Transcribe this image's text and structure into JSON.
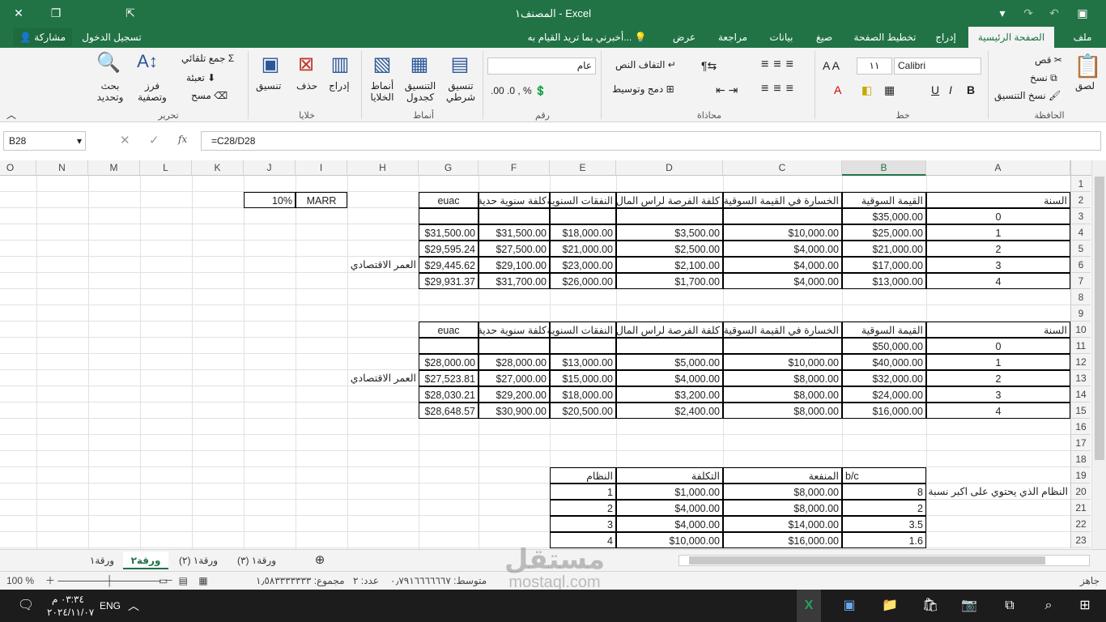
{
  "window": {
    "title": "المصنف١ - Excel",
    "close_glyph": "✕",
    "restore_glyph": "❐",
    "minimize_glyph": "⇱",
    "save_glyph": "▣",
    "undo_glyph": "↶",
    "redo_glyph": "↷",
    "customize_glyph": "▾"
  },
  "tabs": {
    "share": "مشاركة",
    "signin": "تسجيل الدخول",
    "tellme": "أخبرني بما تريد القيام به...",
    "items": [
      "ملف",
      "الصفحة الرئيسية",
      "إدراج",
      "تخطيط الصفحة",
      "صيغ",
      "بيانات",
      "مراجعة",
      "عرض"
    ]
  },
  "ribbon": {
    "clipboard": {
      "label": "الحافظة",
      "paste": "لصق",
      "cut": "قص",
      "copy": "نسخ",
      "format_painter": "نسخ التنسيق"
    },
    "font": {
      "label": "خط",
      "name": "Calibri",
      "size": "١١"
    },
    "alignment": {
      "label": "محاذاة",
      "wrap": "التفاف النص",
      "merge": "دمج وتوسيط"
    },
    "number": {
      "label": "رقم",
      "format": "عام"
    },
    "styles": {
      "label": "أنماط",
      "conditional": "تنسيق شرطي",
      "as_table": "التنسيق كجدول",
      "cell_styles": "أنماط الخلايا"
    },
    "cells": {
      "label": "خلايا",
      "insert": "إدراج",
      "delete": "حذف",
      "format": "تنسيق"
    },
    "editing": {
      "label": "تحرير",
      "autosum": "جمع تلقائي",
      "fill": "تعبئة",
      "clear": "مسح",
      "sort": "فرز وتصفية",
      "find": "بحث وتحديد"
    }
  },
  "formula_bar": {
    "name_box": "B28",
    "fx": "fx",
    "formula": "=C28/D28"
  },
  "grid": {
    "columns": [
      "A",
      "B",
      "C",
      "D",
      "E",
      "F",
      "G",
      "H",
      "I",
      "J",
      "K",
      "L",
      "M",
      "N",
      "O"
    ],
    "selected_column": "B",
    "rows": [
      "1",
      "2",
      "3",
      "4",
      "5",
      "6",
      "7",
      "8",
      "9",
      "10",
      "11",
      "12",
      "13",
      "14",
      "15",
      "16",
      "17",
      "18",
      "19",
      "20",
      "21",
      "22",
      "23"
    ],
    "headers": [
      "السنة",
      "القيمة السوقية",
      "الخسارة في القيمة السوقية",
      "كلفة الفرصة لراس المال",
      "النفقات السنوية",
      "كلفة سنوية حدية",
      "euac"
    ],
    "marr_label": "MARR",
    "marr_value": "10%",
    "economic_life": "العمر الاقتصادي",
    "table1": [
      [
        "0",
        "$35,000.00",
        "",
        "",
        "",
        "",
        ""
      ],
      [
        "1",
        "$25,000.00",
        "$10,000.00",
        "$3,500.00",
        "$18,000.00",
        "$31,500.00",
        "$31,500.00"
      ],
      [
        "2",
        "$21,000.00",
        "$4,000.00",
        "$2,500.00",
        "$21,000.00",
        "$27,500.00",
        "$29,595.24"
      ],
      [
        "3",
        "$17,000.00",
        "$4,000.00",
        "$2,100.00",
        "$23,000.00",
        "$29,100.00",
        "$29,445.62"
      ],
      [
        "4",
        "$13,000.00",
        "$4,000.00",
        "$1,700.00",
        "$26,000.00",
        "$31,700.00",
        "$29,931.37"
      ]
    ],
    "table2": [
      [
        "0",
        "$50,000.00",
        "",
        "",
        "",
        "",
        ""
      ],
      [
        "1",
        "$40,000.00",
        "$10,000.00",
        "$5,000.00",
        "$13,000.00",
        "$28,000.00",
        "$28,000.00"
      ],
      [
        "2",
        "$32,000.00",
        "$8,000.00",
        "$4,000.00",
        "$15,000.00",
        "$27,000.00",
        "$27,523.81"
      ],
      [
        "3",
        "$24,000.00",
        "$8,000.00",
        "$3,200.00",
        "$18,000.00",
        "$29,200.00",
        "$28,030.21"
      ],
      [
        "4",
        "$16,000.00",
        "$8,000.00",
        "$2,400.00",
        "$20,500.00",
        "$30,900.00",
        "$28,648.57"
      ]
    ],
    "table3_headers": [
      "b/c",
      "المنفعة",
      "التكلفة",
      "النظام"
    ],
    "table3": [
      [
        "8",
        "$8,000.00",
        "$1,000.00",
        "1"
      ],
      [
        "2",
        "$8,000.00",
        "$4,000.00",
        "2"
      ],
      [
        "3.5",
        "$14,000.00",
        "$4,000.00",
        "3"
      ],
      [
        "1.6",
        "$16,000.00",
        "$10,000.00",
        "4"
      ]
    ],
    "best_system_note": "النظام الذي يحتوي على اكبر نسبة"
  },
  "sheets": [
    "ورقة١",
    "ورقة٢",
    "ورقة١ (٢)",
    "ورقة١ (٣)"
  ],
  "active_sheet": "ورقة٢",
  "add_sheet": "⊕",
  "status": {
    "ready": "جاهز",
    "average": "متوسط: ٠٫٧٩١٦٦٦٦٦٦٧",
    "count": "عدد: ٢",
    "sum": "مجموع: ١٫٥٨٣٣٣٣٣٣٣",
    "zoom": "100 %"
  },
  "taskbar": {
    "time": "٠٣:٣٤ م",
    "date": "٢٠٢٤/١١/٠٧",
    "lang": "ENG"
  },
  "watermark": {
    "brand": "مستقل",
    "url": "mostaql.com"
  },
  "colors": {
    "excel_green": "#217346",
    "ribbon_bg": "#f3f3f3"
  }
}
